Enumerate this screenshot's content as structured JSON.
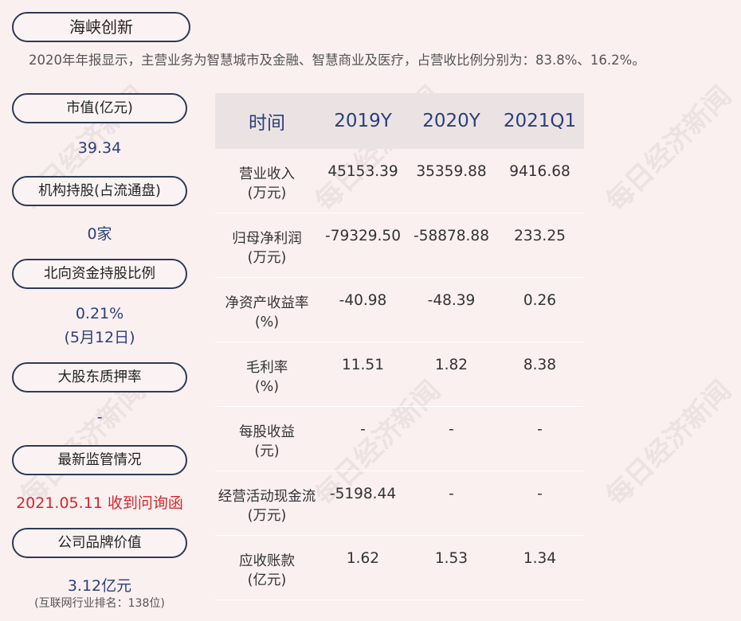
{
  "title": "海峡创新",
  "summary": "2020年年报显示，主营业务为智慧城市及金融、智慧商业及医疗，占营收比例分别为：83.8%、16.2%。",
  "sidebar": {
    "market_cap_label": "市值(亿元)",
    "market_cap_value": "39.34",
    "institution_label": "机构持股(占流通盘)",
    "institution_value": "0家",
    "northbound_label": "北向资金持股比例",
    "northbound_value": "0.21%",
    "northbound_date": "(5月12日)",
    "pledge_label": "大股东质押率",
    "pledge_value": "-",
    "regulation_label": "最新监管情况",
    "regulation_value": "2021.05.11 收到问询函",
    "brand_label": "公司品牌价值",
    "brand_value": "3.12亿元",
    "brand_note": "(互联网行业排名：138位)"
  },
  "table": {
    "headers": [
      "时间",
      "2019Y",
      "2020Y",
      "2021Q1"
    ],
    "rows": [
      {
        "label": "营业收入",
        "unit": "(万元)",
        "values": [
          "45153.39",
          "35359.88",
          "9416.68"
        ]
      },
      {
        "label": "归母净利润",
        "unit": "(万元)",
        "values": [
          "-79329.50",
          "-58878.88",
          "233.25"
        ]
      },
      {
        "label": "净资产收益率",
        "unit": "(%)",
        "values": [
          "-40.98",
          "-48.39",
          "0.26"
        ]
      },
      {
        "label": "毛利率",
        "unit": "(%)",
        "values": [
          "11.51",
          "1.82",
          "8.38"
        ]
      },
      {
        "label": "每股收益",
        "unit": "(元)",
        "values": [
          "-",
          "-",
          "-"
        ]
      },
      {
        "label": "经营活动现金流",
        "unit": "(万元)",
        "values": [
          "-5198.44",
          "-",
          "-"
        ]
      },
      {
        "label": "应收账款",
        "unit": "(亿元)",
        "values": [
          "1.62",
          "1.53",
          "1.34"
        ]
      }
    ]
  },
  "watermark": "每日经济新闻",
  "colors": {
    "accent_blue": "#2b3f7a",
    "alert_red": "#d7262b",
    "background": "#faf0f0",
    "header_bg": "#ebe3e3"
  }
}
